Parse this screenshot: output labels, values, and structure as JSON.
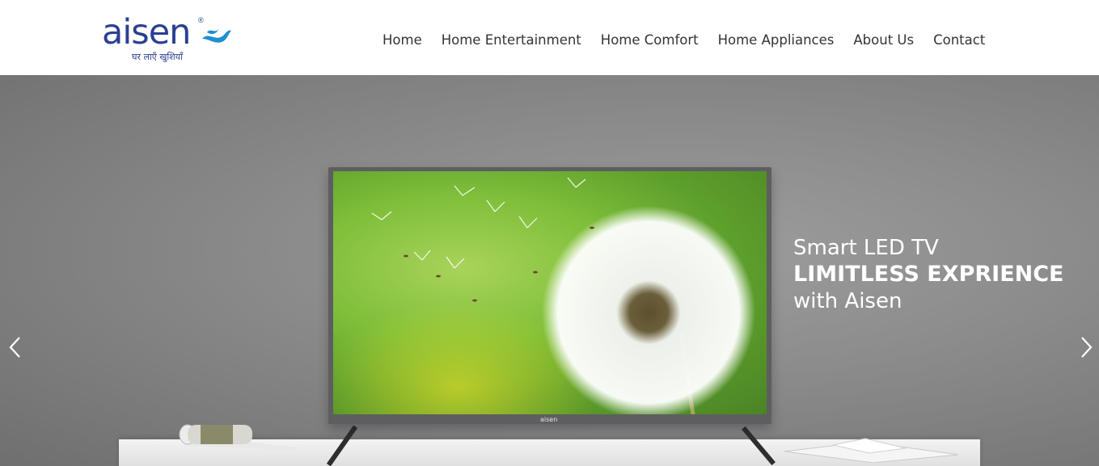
{
  "brand": {
    "name": "aisen",
    "registered_mark": "®",
    "tagline": "घर लाएँ खुशियाँ",
    "color": "#2b3f91",
    "wave_color": "#1f8fd0"
  },
  "nav": {
    "items": [
      {
        "label": "Home"
      },
      {
        "label": "Home Entertainment"
      },
      {
        "label": "Home Comfort"
      },
      {
        "label": "Home Appliances"
      },
      {
        "label": "About Us"
      },
      {
        "label": "Contact"
      }
    ]
  },
  "hero": {
    "line1": "Smart LED TV",
    "line2": "LIMITLESS EXPRIENCE",
    "line3": "with Aisen",
    "tv_brand": "aisen",
    "prev_icon": "chevron-left-icon",
    "next_icon": "chevron-right-icon"
  }
}
